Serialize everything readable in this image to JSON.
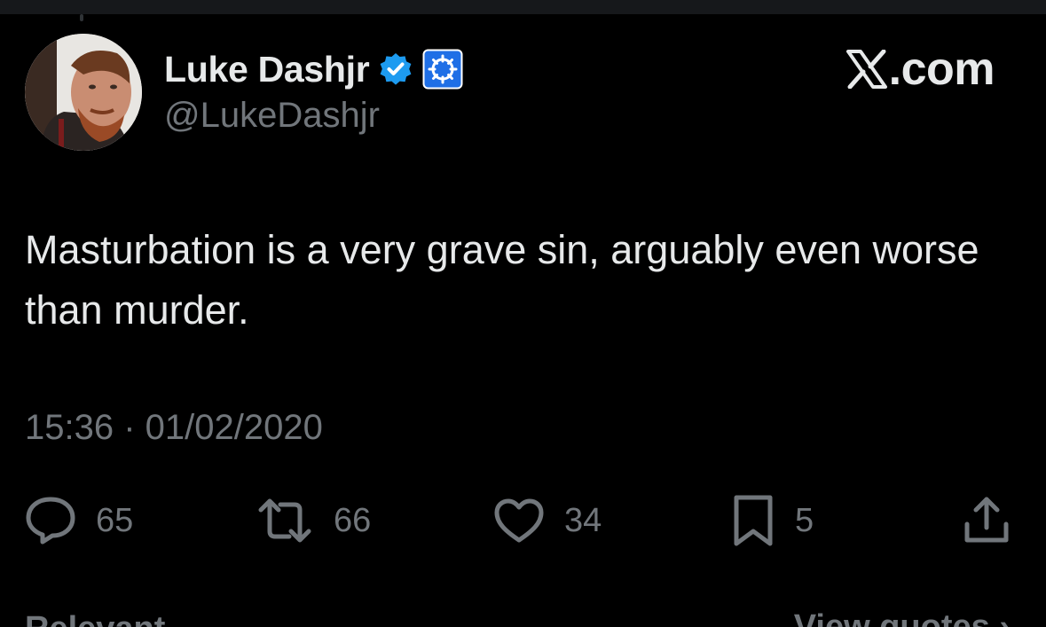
{
  "author": {
    "display_name": "Luke Dashjr",
    "handle": "@LukeDashjr",
    "verified_badge_icon": "verified-check-icon",
    "affiliate_badge_icon": "affiliate-logo-icon"
  },
  "brand": {
    "label": ".com",
    "icon": "x-logo-icon"
  },
  "tweet": {
    "text": "Masturbation is a very grave sin, arguably even worse than murder.",
    "timestamp": "15:36 · 01/02/2020"
  },
  "actions": {
    "replies": "65",
    "reposts": "66",
    "likes": "34",
    "bookmarks": "5"
  },
  "footer": {
    "sort_label": "Relevant ⌄",
    "quotes_label": "View quotes ›"
  },
  "colors": {
    "background": "#000000",
    "text_primary": "#e7e9ea",
    "text_secondary": "#71767b",
    "verified_blue": "#1d9bf0"
  }
}
